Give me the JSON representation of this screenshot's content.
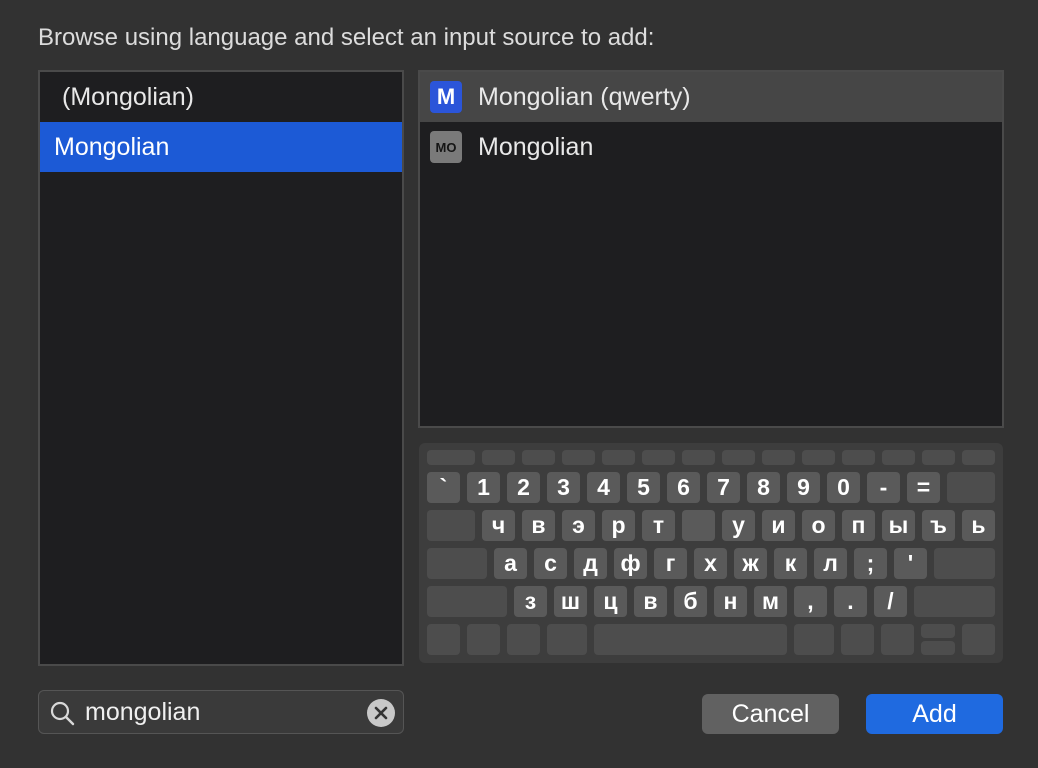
{
  "dialog": {
    "prompt": "Browse using language and select an input source to add:"
  },
  "languages": [
    {
      "label": "(Mongolian)",
      "selected": false
    },
    {
      "label": "Mongolian",
      "selected": true
    }
  ],
  "sources": [
    {
      "label": "Mongolian (qwerty)",
      "icon_text": "M",
      "icon": "mongolian-qwerty-icon",
      "selected": true
    },
    {
      "label": "Mongolian",
      "icon_text": "MO",
      "icon": "mongolian-icon",
      "selected": false
    }
  ],
  "keyboard": {
    "row1": [
      "`",
      "1",
      "2",
      "3",
      "4",
      "5",
      "6",
      "7",
      "8",
      "9",
      "0",
      "-",
      "="
    ],
    "row2": [
      "ч",
      "в",
      "э",
      "р",
      "т",
      "",
      "у",
      "и",
      "о",
      "п",
      "ы",
      "ъ",
      "ь"
    ],
    "row3": [
      "а",
      "с",
      "д",
      "ф",
      "г",
      "х",
      "ж",
      "к",
      "л",
      ";",
      "'"
    ],
    "row4": [
      "з",
      "ш",
      "ц",
      "в",
      "б",
      "н",
      "м",
      ",",
      ".",
      "/"
    ]
  },
  "search": {
    "value": "mongolian",
    "icon": "search-icon",
    "clear_icon": "clear-icon"
  },
  "buttons": {
    "cancel": "Cancel",
    "add": "Add"
  },
  "colors": {
    "accent": "#1c5ad6",
    "background": "#323232",
    "list_background": "#1e1e20"
  }
}
